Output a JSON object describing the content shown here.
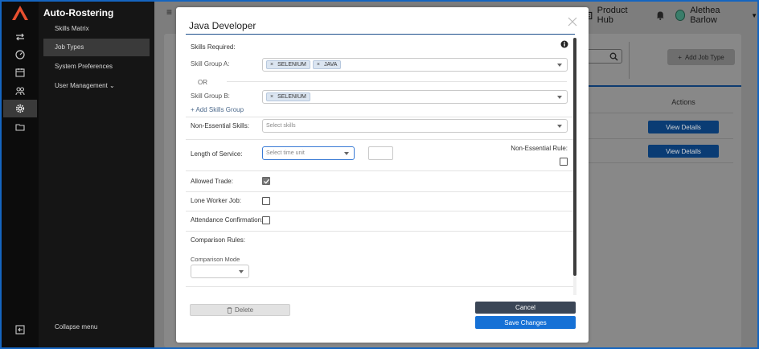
{
  "app": {
    "title": "Auto-Rostering",
    "brand_color": "#e8502f"
  },
  "rail": {
    "icons": [
      "swap-icon",
      "gauge-icon",
      "calendar-icon",
      "people-icon",
      "gear-icon",
      "folder-icon"
    ],
    "collapse_icon": "collapse-icon"
  },
  "menu": {
    "items": [
      {
        "label": "Skills Matrix"
      },
      {
        "label": "Job Types"
      },
      {
        "label": "System Preferences"
      },
      {
        "label": "User Management ⌄"
      }
    ],
    "collapse_label": "Collapse menu"
  },
  "header": {
    "product_hub": "Product Hub",
    "user_name": "Alethea Barlow"
  },
  "background": {
    "add_job_type": "Add Job Type",
    "actions_header": "Actions",
    "view_details": [
      "View Details",
      "View Details"
    ]
  },
  "modal": {
    "title": "Java Developer",
    "skills_required_label": "Skills Required:",
    "skill_group_a_label": "Skill Group A:",
    "skill_group_a_chips": [
      "SELENIUM",
      "JAVA"
    ],
    "or_label": "OR",
    "skill_group_b_label": "Skill Group B:",
    "skill_group_b_chips": [
      "SELENIUM"
    ],
    "add_group_label": "+ Add Skills Group",
    "non_essential_skills_label": "Non-Essential Skills:",
    "non_essential_skills_placeholder": "Select skills",
    "length_of_service_label": "Length of Service:",
    "time_unit_placeholder": "Select time unit",
    "non_essential_rule_label": "Non-Essential Rule:",
    "non_essential_rule_checked": false,
    "allowed_trade_label": "Allowed Trade:",
    "allowed_trade_checked": true,
    "lone_worker_label": "Lone Worker Job:",
    "lone_worker_checked": false,
    "attendance_label": "Attendance Confirmation:",
    "attendance_checked": false,
    "comparison_rules_label": "Comparison Rules:",
    "comparison_mode_label": "Comparison Mode",
    "delete_label": "Delete",
    "cancel_label": "Cancel",
    "save_label": "Save Changes"
  }
}
